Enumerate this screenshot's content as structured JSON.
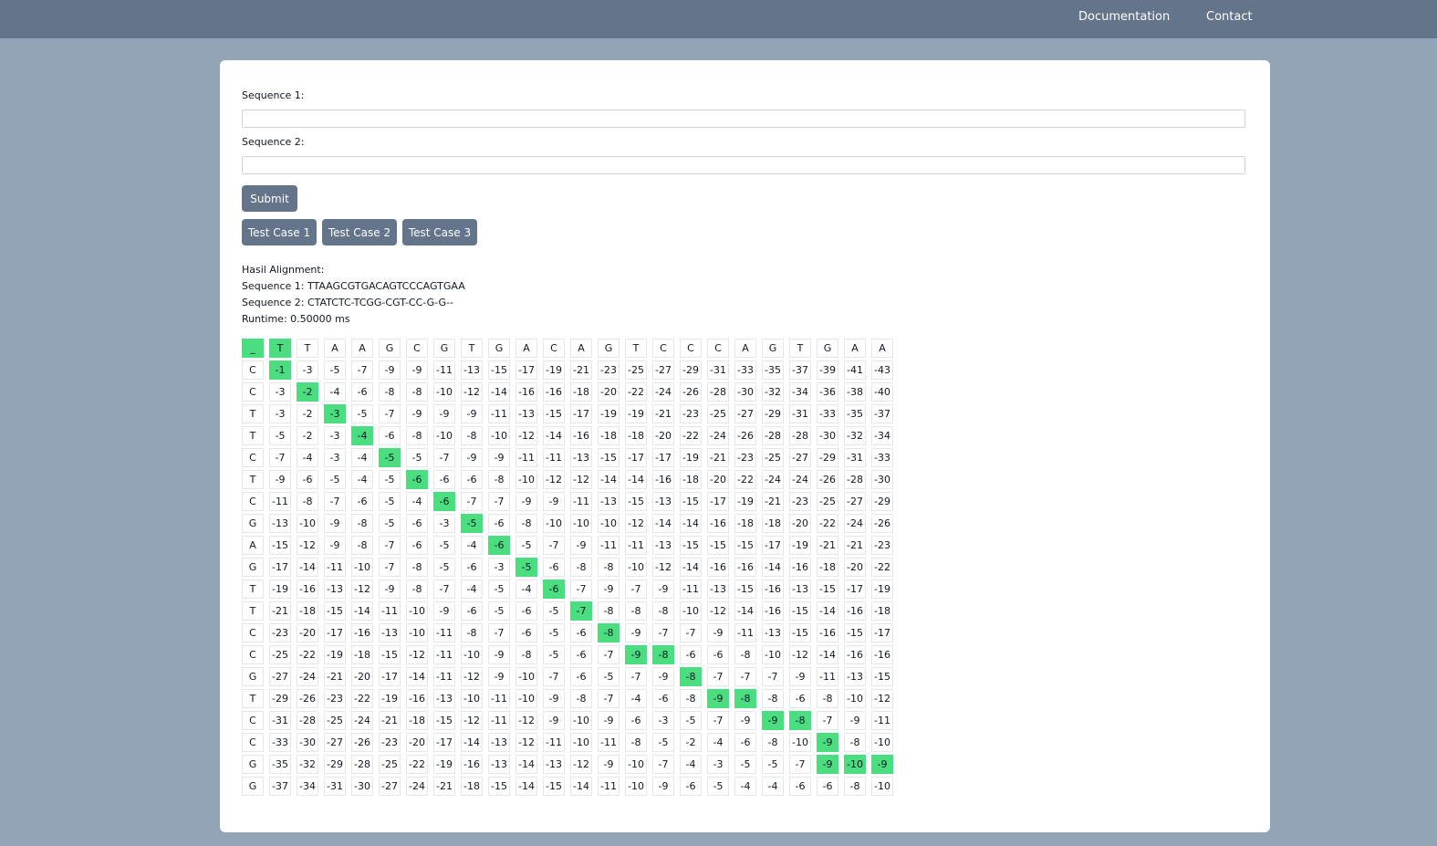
{
  "nav": {
    "documentation": "Documentation",
    "contact": "Contact"
  },
  "form": {
    "seq1_label": "Sequence 1:",
    "seq1_value": "",
    "seq2_label": "Sequence 2:",
    "seq2_value": "",
    "submit_label": "Submit",
    "test_cases": [
      "Test Case 1",
      "Test Case 2",
      "Test Case 3"
    ]
  },
  "result": {
    "heading": "Hasil Alignment:",
    "seq1": "Sequence 1: TTAAGCGTGACAGTCCCAGTGAA",
    "seq2": "Sequence 2: CTATCTC-TCGG-CGT-CC-G-G--",
    "runtime": "Runtime: 0.50000 ms"
  },
  "colors": {
    "topbar": "#64748b",
    "background": "#94a3b8",
    "button": "#64748b",
    "path_highlight": "#4ade80"
  },
  "matrix": {
    "header": [
      "_",
      "T",
      "T",
      "A",
      "A",
      "G",
      "C",
      "G",
      "T",
      "G",
      "A",
      "C",
      "A",
      "G",
      "T",
      "C",
      "C",
      "C",
      "A",
      "G",
      "T",
      "G",
      "A",
      "A"
    ],
    "rows": [
      {
        "label": "C",
        "values": [
          "-1",
          "-3",
          "-5",
          "-7",
          "-9",
          "-9",
          "-11",
          "-13",
          "-15",
          "-17",
          "-19",
          "-21",
          "-23",
          "-25",
          "-27",
          "-29",
          "-31",
          "-33",
          "-35",
          "-37",
          "-39",
          "-41",
          "-43"
        ]
      },
      {
        "label": "C",
        "values": [
          "-3",
          "-2",
          "-4",
          "-6",
          "-8",
          "-8",
          "-10",
          "-12",
          "-14",
          "-16",
          "-16",
          "-18",
          "-20",
          "-22",
          "-24",
          "-26",
          "-28",
          "-30",
          "-32",
          "-34",
          "-36",
          "-38",
          "-40"
        ]
      },
      {
        "label": "T",
        "values": [
          "-3",
          "-2",
          "-3",
          "-5",
          "-7",
          "-9",
          "-9",
          "-9",
          "-11",
          "-13",
          "-15",
          "-17",
          "-19",
          "-19",
          "-21",
          "-23",
          "-25",
          "-27",
          "-29",
          "-31",
          "-33",
          "-35",
          "-37"
        ]
      },
      {
        "label": "T",
        "values": [
          "-5",
          "-2",
          "-3",
          "-4",
          "-6",
          "-8",
          "-10",
          "-8",
          "-10",
          "-12",
          "-14",
          "-16",
          "-18",
          "-18",
          "-20",
          "-22",
          "-24",
          "-26",
          "-28",
          "-28",
          "-30",
          "-32",
          "-34"
        ]
      },
      {
        "label": "C",
        "values": [
          "-7",
          "-4",
          "-3",
          "-4",
          "-5",
          "-5",
          "-7",
          "-9",
          "-9",
          "-11",
          "-11",
          "-13",
          "-15",
          "-17",
          "-17",
          "-19",
          "-21",
          "-23",
          "-25",
          "-27",
          "-29",
          "-31",
          "-33"
        ]
      },
      {
        "label": "T",
        "values": [
          "-9",
          "-6",
          "-5",
          "-4",
          "-5",
          "-6",
          "-6",
          "-6",
          "-8",
          "-10",
          "-12",
          "-12",
          "-14",
          "-14",
          "-16",
          "-18",
          "-20",
          "-22",
          "-24",
          "-24",
          "-26",
          "-28",
          "-30"
        ]
      },
      {
        "label": "C",
        "values": [
          "-11",
          "-8",
          "-7",
          "-6",
          "-5",
          "-4",
          "-6",
          "-7",
          "-7",
          "-9",
          "-9",
          "-11",
          "-13",
          "-15",
          "-13",
          "-15",
          "-17",
          "-19",
          "-21",
          "-23",
          "-25",
          "-27",
          "-29"
        ]
      },
      {
        "label": "G",
        "values": [
          "-13",
          "-10",
          "-9",
          "-8",
          "-5",
          "-6",
          "-3",
          "-5",
          "-6",
          "-8",
          "-10",
          "-10",
          "-10",
          "-12",
          "-14",
          "-14",
          "-16",
          "-18",
          "-18",
          "-20",
          "-22",
          "-24",
          "-26"
        ]
      },
      {
        "label": "A",
        "values": [
          "-15",
          "-12",
          "-9",
          "-8",
          "-7",
          "-6",
          "-5",
          "-4",
          "-6",
          "-5",
          "-7",
          "-9",
          "-11",
          "-11",
          "-13",
          "-15",
          "-15",
          "-15",
          "-17",
          "-19",
          "-21",
          "-21",
          "-23"
        ]
      },
      {
        "label": "G",
        "values": [
          "-17",
          "-14",
          "-11",
          "-10",
          "-7",
          "-8",
          "-5",
          "-6",
          "-3",
          "-5",
          "-6",
          "-8",
          "-8",
          "-10",
          "-12",
          "-14",
          "-16",
          "-16",
          "-14",
          "-16",
          "-18",
          "-20",
          "-22"
        ]
      },
      {
        "label": "T",
        "values": [
          "-19",
          "-16",
          "-13",
          "-12",
          "-9",
          "-8",
          "-7",
          "-4",
          "-5",
          "-4",
          "-6",
          "-7",
          "-9",
          "-7",
          "-9",
          "-11",
          "-13",
          "-15",
          "-16",
          "-13",
          "-15",
          "-17",
          "-19"
        ]
      },
      {
        "label": "T",
        "values": [
          "-21",
          "-18",
          "-15",
          "-14",
          "-11",
          "-10",
          "-9",
          "-6",
          "-5",
          "-6",
          "-5",
          "-7",
          "-8",
          "-8",
          "-8",
          "-10",
          "-12",
          "-14",
          "-16",
          "-15",
          "-14",
          "-16",
          "-18"
        ]
      },
      {
        "label": "C",
        "values": [
          "-23",
          "-20",
          "-17",
          "-16",
          "-13",
          "-10",
          "-11",
          "-8",
          "-7",
          "-6",
          "-5",
          "-6",
          "-8",
          "-9",
          "-7",
          "-7",
          "-9",
          "-11",
          "-13",
          "-15",
          "-16",
          "-15",
          "-17"
        ]
      },
      {
        "label": "C",
        "values": [
          "-25",
          "-22",
          "-19",
          "-18",
          "-15",
          "-12",
          "-11",
          "-10",
          "-9",
          "-8",
          "-5",
          "-6",
          "-7",
          "-9",
          "-8",
          "-6",
          "-6",
          "-8",
          "-10",
          "-12",
          "-14",
          "-16",
          "-16"
        ]
      },
      {
        "label": "G",
        "values": [
          "-27",
          "-24",
          "-21",
          "-20",
          "-17",
          "-14",
          "-11",
          "-12",
          "-9",
          "-10",
          "-7",
          "-6",
          "-5",
          "-7",
          "-9",
          "-8",
          "-7",
          "-7",
          "-7",
          "-9",
          "-11",
          "-13",
          "-15"
        ]
      },
      {
        "label": "T",
        "values": [
          "-29",
          "-26",
          "-23",
          "-22",
          "-19",
          "-16",
          "-13",
          "-10",
          "-11",
          "-10",
          "-9",
          "-8",
          "-7",
          "-4",
          "-6",
          "-8",
          "-9",
          "-8",
          "-8",
          "-6",
          "-8",
          "-10",
          "-12"
        ]
      },
      {
        "label": "C",
        "values": [
          "-31",
          "-28",
          "-25",
          "-24",
          "-21",
          "-18",
          "-15",
          "-12",
          "-11",
          "-12",
          "-9",
          "-10",
          "-9",
          "-6",
          "-3",
          "-5",
          "-7",
          "-9",
          "-9",
          "-8",
          "-7",
          "-9",
          "-11"
        ]
      },
      {
        "label": "C",
        "values": [
          "-33",
          "-30",
          "-27",
          "-26",
          "-23",
          "-20",
          "-17",
          "-14",
          "-13",
          "-12",
          "-11",
          "-10",
          "-11",
          "-8",
          "-5",
          "-2",
          "-4",
          "-6",
          "-8",
          "-10",
          "-9",
          "-8",
          "-10"
        ]
      },
      {
        "label": "G",
        "values": [
          "-35",
          "-32",
          "-29",
          "-28",
          "-25",
          "-22",
          "-19",
          "-16",
          "-13",
          "-14",
          "-13",
          "-12",
          "-9",
          "-10",
          "-7",
          "-4",
          "-3",
          "-5",
          "-5",
          "-7",
          "-9",
          "-10",
          "-9"
        ]
      },
      {
        "label": "G",
        "values": [
          "-37",
          "-34",
          "-31",
          "-30",
          "-27",
          "-24",
          "-21",
          "-18",
          "-15",
          "-14",
          "-15",
          "-14",
          "-11",
          "-10",
          "-9",
          "-6",
          "-5",
          "-4",
          "-4",
          "-6",
          "-6",
          "-8",
          "-10"
        ]
      }
    ],
    "highlighted": [
      [
        0,
        0
      ],
      [
        0,
        1
      ],
      [
        1,
        1
      ],
      [
        2,
        2
      ],
      [
        3,
        3
      ],
      [
        4,
        4
      ],
      [
        5,
        5
      ],
      [
        6,
        6
      ],
      [
        7,
        7
      ],
      [
        8,
        8
      ],
      [
        9,
        9
      ],
      [
        10,
        10
      ],
      [
        11,
        11
      ],
      [
        12,
        12
      ],
      [
        13,
        13
      ],
      [
        14,
        14
      ],
      [
        14,
        15
      ],
      [
        15,
        16
      ],
      [
        16,
        17
      ],
      [
        16,
        18
      ],
      [
        17,
        19
      ],
      [
        17,
        20
      ],
      [
        18,
        21
      ],
      [
        19,
        21
      ],
      [
        19,
        22
      ],
      [
        19,
        23
      ]
    ]
  }
}
